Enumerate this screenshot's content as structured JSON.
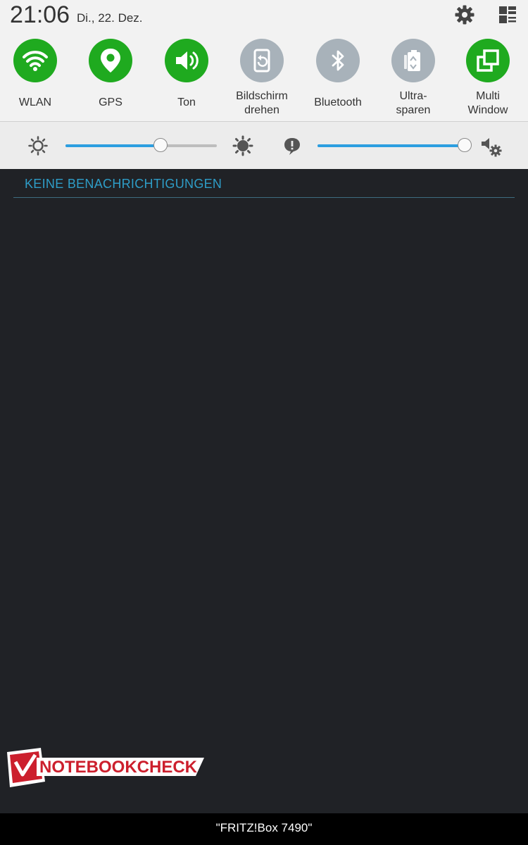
{
  "status": {
    "time": "21:06",
    "date": "Di., 22. Dez.",
    "icons": [
      "gear-icon",
      "quick-panel-edit-icon"
    ]
  },
  "toggles": [
    {
      "label": "WLAN",
      "icon": "wifi-icon",
      "on": true
    },
    {
      "label": "GPS",
      "icon": "location-pin-icon",
      "on": true
    },
    {
      "label": "Ton",
      "icon": "speaker-icon",
      "on": true
    },
    {
      "label": "Bildschirm drehen",
      "icon": "screen-rotate-icon",
      "on": false
    },
    {
      "label": "Bluetooth",
      "icon": "bluetooth-icon",
      "on": false
    },
    {
      "label": "Ultra-sparen",
      "icon": "ultra-power-saving-icon",
      "on": false
    },
    {
      "label": "Multi Window",
      "icon": "multi-window-icon",
      "on": true
    }
  ],
  "colors": {
    "toggle_on": "#1faa1f",
    "toggle_off": "#a8b2ba",
    "accent": "#2c9ee0",
    "notification_title": "#2e9dc7"
  },
  "sliders": {
    "brightness": {
      "value": 0.63,
      "icons": [
        "brightness-low-icon",
        "brightness-high-icon"
      ]
    },
    "volume": {
      "value": 1.0,
      "icons": [
        "notification-volume-icon",
        "sound-settings-icon"
      ]
    }
  },
  "notifications": {
    "empty_label": "KEINE BENACHRICHTIGUNGEN"
  },
  "watermark": {
    "text": "NOTEBOOKCHECK"
  },
  "bottom": {
    "network_name": "\"FRITZ!Box 7490\""
  }
}
